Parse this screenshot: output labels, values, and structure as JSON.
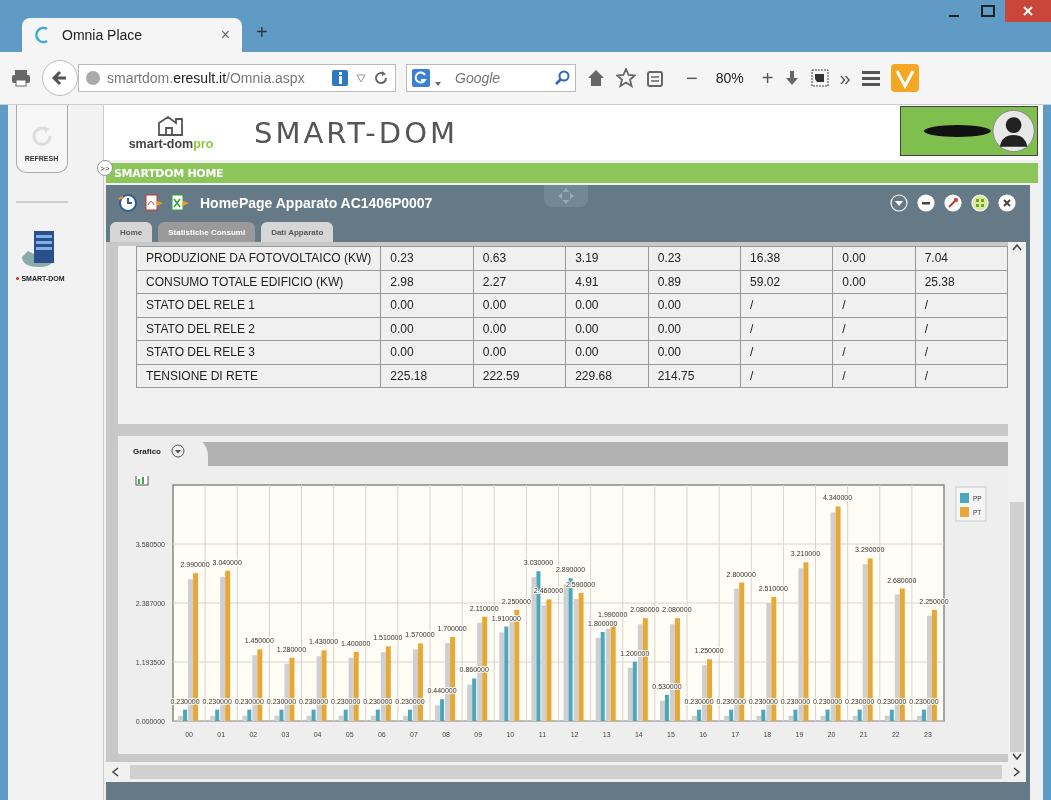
{
  "browser": {
    "tab": {
      "title": "Omnia Place",
      "close": "×"
    },
    "new_tab": "+",
    "url": "smartdom.**eresult.it**/Omnia.aspx",
    "search": {
      "placeholder": "Google"
    },
    "zoom": {
      "out": "−",
      "level": "80%",
      "in": "+"
    },
    "overflow": "»"
  },
  "sidebar": {
    "refresh": "REFRESH",
    "toggle": ">>",
    "apps": [
      {
        "label": "SMART-DOM",
        "selected": true
      }
    ]
  },
  "header": {
    "logo_text": "smart-dom",
    "logo_suffix": "pro",
    "title": "SMART-DOM"
  },
  "nav": {
    "title": "SMARTDOM HOME"
  },
  "panel": {
    "title": "HomePage Apparato AC1406P0007",
    "tabs": [
      {
        "label": "Home",
        "selected": false
      },
      {
        "label": "Statistiche Consumi",
        "selected": true
      },
      {
        "label": "Dati Apparato",
        "selected": false
      }
    ]
  },
  "table": {
    "rows": [
      {
        "label": "PRODUZIONE DA FOTOVOLTAICO (KW)",
        "cells": [
          "0.23",
          "0.63",
          "3.19",
          "0.23",
          "16.38",
          "0.00",
          "7.04"
        ]
      },
      {
        "label": "CONSUMO TOTALE EDIFICIO (KW)",
        "cells": [
          "2.98",
          "2.27",
          "4.91",
          "0.89",
          "59.02",
          "0.00",
          "25.38"
        ]
      },
      {
        "label": "STATO DEL RELE 1",
        "cells": [
          "0.00",
          "0.00",
          "0.00",
          "0.00",
          "/",
          "/",
          "/"
        ]
      },
      {
        "label": "STATO DEL RELE 2",
        "cells": [
          "0.00",
          "0.00",
          "0.00",
          "0.00",
          "/",
          "/",
          "/"
        ]
      },
      {
        "label": "STATO DEL RELE 3",
        "cells": [
          "0.00",
          "0.00",
          "0.00",
          "0.00",
          "/",
          "/",
          "/"
        ]
      },
      {
        "label": "TENSIONE DI RETE",
        "cells": [
          "225.18",
          "222.59",
          "229.68",
          "214.75",
          "/",
          "/",
          "/"
        ]
      }
    ]
  },
  "chart_section": {
    "tab": "Grafico",
    "chart_data": {
      "type": "bar",
      "categories": [
        "00",
        "01",
        "02",
        "03",
        "04",
        "05",
        "06",
        "07",
        "08",
        "09",
        "10",
        "11",
        "12",
        "13",
        "14",
        "15",
        "16",
        "17",
        "18",
        "19",
        "20",
        "21",
        "22",
        "23"
      ],
      "series": [
        {
          "name": "PP",
          "color": "#4aa8be",
          "values": [
            0.23,
            0.23,
            0.23,
            0.23,
            0.23,
            0.23,
            0.23,
            0.23,
            0.44,
            0.86,
            1.91,
            3.03,
            2.89,
            1.8,
            1.2,
            0.53,
            0.23,
            0.23,
            0.23,
            0.23,
            0.23,
            0.23,
            0.23,
            0.23
          ],
          "value_labels": [
            "0.230000",
            "0.230000",
            "0.230000",
            "0.230000",
            "0.230000",
            "0.230000",
            "0.230000",
            "0.230000",
            "0.440000",
            "0.860000",
            "1.910000",
            "3.030000",
            "2.890000",
            "1.800000",
            "1.200000",
            "0.530000",
            "0.230000",
            "0.230000",
            "0.230000",
            "0.230000",
            "0.230000",
            "0.230000",
            "0.230000",
            "0.230000"
          ]
        },
        {
          "name": "PT",
          "color": "#e8a838",
          "values": [
            2.99,
            3.04,
            1.45,
            1.28,
            1.43,
            1.4,
            1.51,
            1.57,
            1.7,
            2.11,
            2.25,
            2.46,
            2.59,
            1.99,
            2.08,
            2.08,
            1.25,
            2.8,
            2.51,
            3.21,
            4.34,
            3.29,
            2.68,
            2.25
          ],
          "value_labels": [
            "2.990000",
            "3.040000",
            "1.450000",
            "1.280000",
            "1.430000",
            "1.400000",
            "1.510000",
            "1.570000",
            "1.700000",
            "2.110000",
            "2.250000",
            "2.460000",
            "2.590000",
            "1.990000",
            "2.080000",
            "2.080000",
            "1.250000",
            "2.800000",
            "2.510000",
            "3.210000",
            "4.340000",
            "3.290000",
            "2.680000",
            "2.250000"
          ]
        }
      ],
      "ylim": [
        0,
        4.774
      ],
      "yticks": [
        {
          "value": 0,
          "label": "0.000000"
        },
        {
          "value": 1.1935,
          "label": "1.193500"
        },
        {
          "value": 2.387,
          "label": "2.387000"
        },
        {
          "value": 3.5805,
          "label": "3.580500"
        }
      ],
      "grid": true,
      "legend": "right"
    }
  }
}
